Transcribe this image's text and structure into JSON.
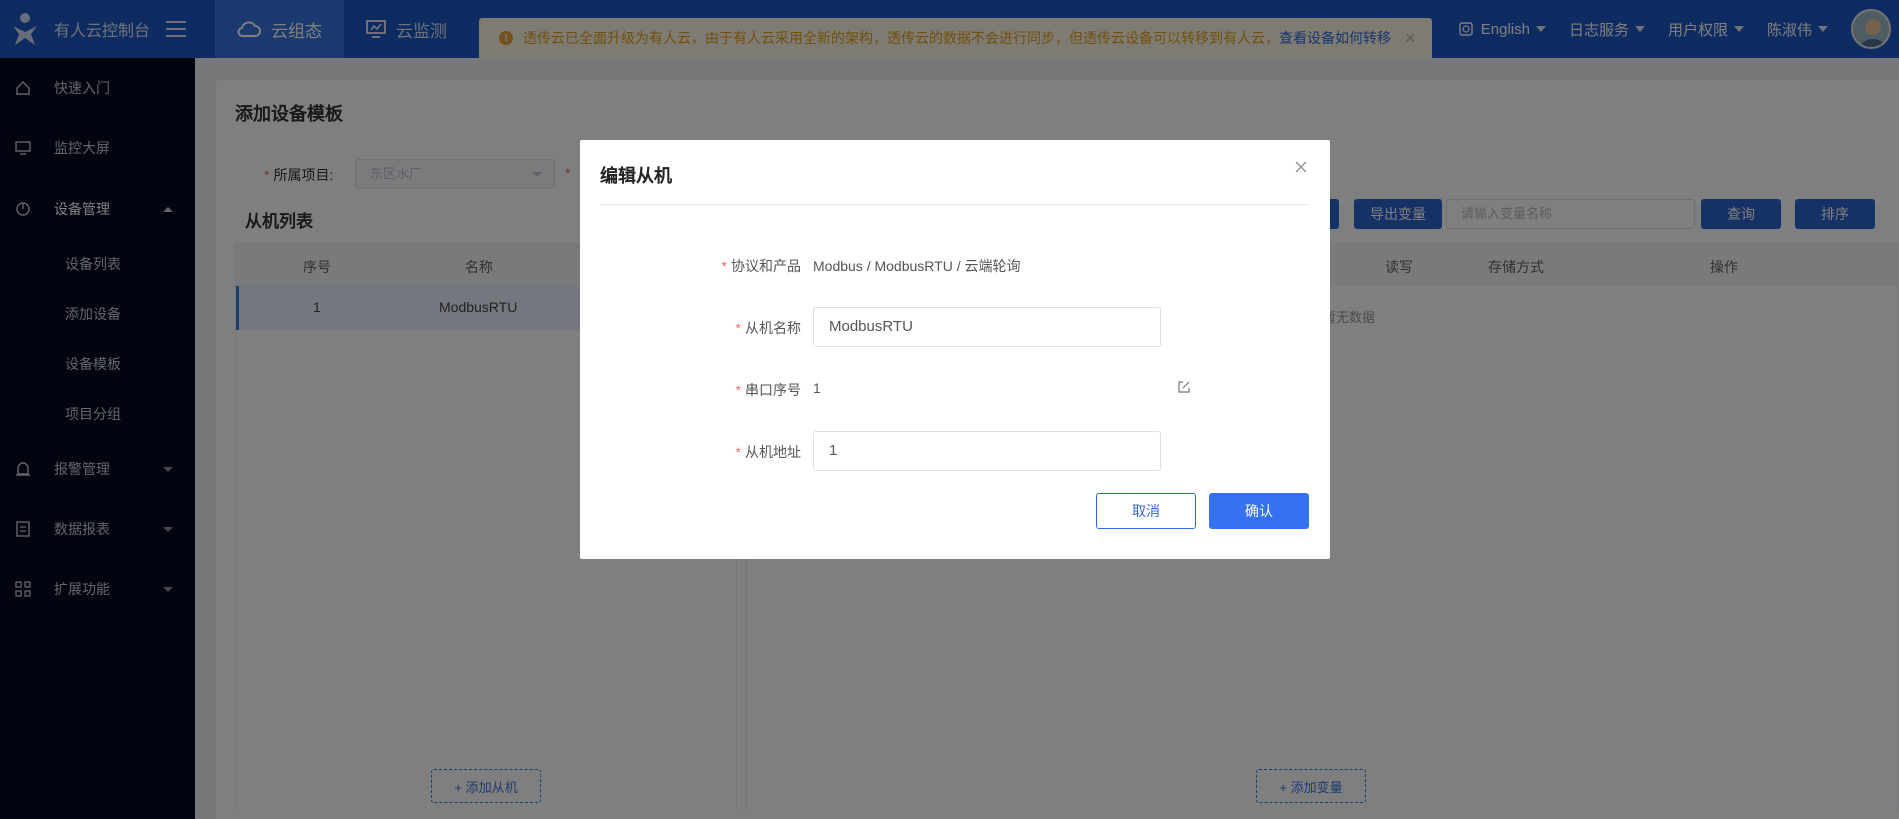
{
  "header": {
    "brand_title": "有人云控制台",
    "nav": [
      {
        "label": "云组态",
        "active": true
      },
      {
        "label": "云监测",
        "active": false
      }
    ],
    "notice": {
      "text": "透传云已全面升级为有人云，由于有人云采用全新的架构，透传云的数据不会进行同步，但透传云设备可以转移到有人云，",
      "link": "查看设备如何转移"
    },
    "right": {
      "language": "English",
      "log_service": "日志服务",
      "user_permission": "用户权限",
      "username": "陈淑伟"
    }
  },
  "sidebar": {
    "items": [
      {
        "label": "快速入门",
        "icon": "home-icon"
      },
      {
        "label": "监控大屏",
        "icon": "monitor-icon"
      },
      {
        "label": "设备管理",
        "icon": "device-icon",
        "expanded": true,
        "children": [
          "设备列表",
          "添加设备",
          "设备模板",
          "项目分组"
        ]
      },
      {
        "label": "报警管理",
        "icon": "alarm-icon"
      },
      {
        "label": "数据报表",
        "icon": "report-icon"
      },
      {
        "label": "扩展功能",
        "icon": "extension-icon"
      }
    ]
  },
  "page": {
    "title": "添加设备模板",
    "project_label": "所属项目:",
    "project_value": "东区水厂",
    "slave_list_title": "从机列表",
    "slave_table": {
      "headers": [
        "序号",
        "名称"
      ],
      "rows": [
        [
          "1",
          "ModbusRTU"
        ]
      ]
    },
    "add_slave": "+ 添加从机",
    "export_vars": "导出变量",
    "search_placeholder": "请输入变量名称",
    "query": "查询",
    "sort": "排序",
    "var_table_headers": [
      "读写",
      "存储方式",
      "操作"
    ],
    "empty_hint": "暂无数据",
    "add_var": "+ 添加变量"
  },
  "modal": {
    "title": "编辑从机",
    "fields": [
      {
        "label": "协议和产品",
        "value": "Modbus / ModbusRTU / 云端轮询",
        "type": "text"
      },
      {
        "label": "从机名称",
        "value": "ModbusRTU",
        "type": "input"
      },
      {
        "label": "串口序号",
        "value": "1",
        "type": "text-edit"
      },
      {
        "label": "从机地址",
        "value": "1",
        "type": "input"
      }
    ],
    "cancel": "取消",
    "confirm": "确认"
  },
  "colors": {
    "header_bg": "#1e58c4",
    "sidebar_bg": "#000b20",
    "primary": "#3472ef",
    "required": "#f56c6c"
  }
}
